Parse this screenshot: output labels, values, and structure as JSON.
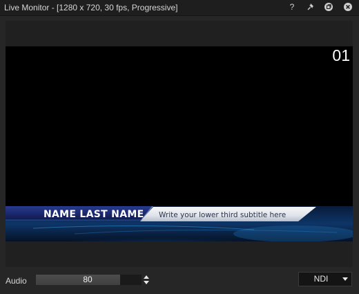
{
  "window": {
    "title": "Live Monitor - [1280 x 720, 30 fps, Progressive]"
  },
  "titlebar_buttons": [
    {
      "name": "help-button",
      "icon": "question-icon",
      "label": "?"
    },
    {
      "name": "pin-button",
      "icon": "pin-icon"
    },
    {
      "name": "restore-button",
      "icon": "restore-window-icon"
    },
    {
      "name": "close-button",
      "icon": "close-icon"
    }
  ],
  "monitor": {
    "channel_number": "01",
    "lower_third": {
      "name": "NAME LAST NAME",
      "subtitle": "Write your lower third subtitle here"
    }
  },
  "audio": {
    "label": "Audio",
    "value": "80",
    "level_fraction": 0.8
  },
  "output": {
    "selected": "NDI"
  },
  "colors": {
    "window_bg": "#262626",
    "video_bg": "#000000",
    "lower_third_blue": "#1d2c6e",
    "subtitle_panel": "#e8ebf0"
  }
}
